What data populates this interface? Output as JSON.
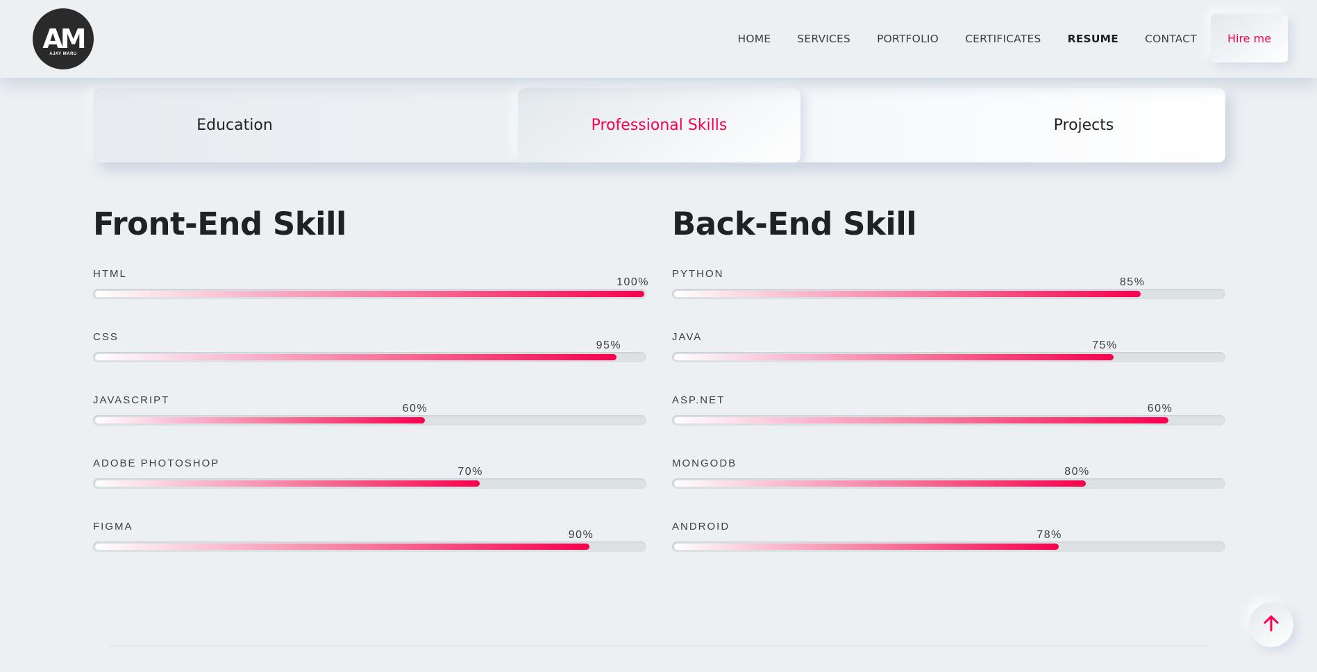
{
  "header": {
    "logo": {
      "mark": "AM",
      "subtitle": "AJAY MARU"
    },
    "nav": [
      "HOME",
      "SERVICES",
      "PORTFOLIO",
      "CERTIFICATES",
      "RESUME",
      "CONTACT"
    ],
    "active_nav": "RESUME",
    "hire_label": "Hire me"
  },
  "tabs": [
    {
      "label": "Education"
    },
    {
      "label": "Professional Skills",
      "active": true
    },
    {
      "label": "Projects"
    }
  ],
  "skills": {
    "front_title": "Front-End Skill",
    "back_title": "Back-End Skill",
    "front": [
      {
        "name": "HTML",
        "percent": "100%",
        "fill": 1.0,
        "label_at": 1.0
      },
      {
        "name": "CSS",
        "percent": "95%",
        "fill": 0.95,
        "label_at": 0.95
      },
      {
        "name": "JAVASCRIPT",
        "percent": "60%",
        "fill": 0.6,
        "label_at": 0.6
      },
      {
        "name": "ADOBE PHOTOSHOP",
        "percent": "70%",
        "fill": 0.7,
        "label_at": 0.7
      },
      {
        "name": "FIGMA",
        "percent": "90%",
        "fill": 0.9,
        "label_at": 0.9
      }
    ],
    "back": [
      {
        "name": "PYTHON",
        "percent": "85%",
        "fill": 0.85,
        "label_at": 0.85
      },
      {
        "name": "JAVA",
        "percent": "75%",
        "fill": 0.8,
        "label_at": 0.8
      },
      {
        "name": "ASP.NET",
        "percent": "60%",
        "fill": 0.9,
        "label_at": 0.9
      },
      {
        "name": "MONGODB",
        "percent": "80%",
        "fill": 0.75,
        "label_at": 0.75
      },
      {
        "name": "ANDROID",
        "percent": "78%",
        "fill": 0.7,
        "label_at": 0.7
      }
    ]
  },
  "colors": {
    "accent": "#f9004d",
    "background": "#ecf0f3",
    "text": "#1f2125"
  },
  "icons": {
    "scroll_top": "arrow-up-icon"
  }
}
